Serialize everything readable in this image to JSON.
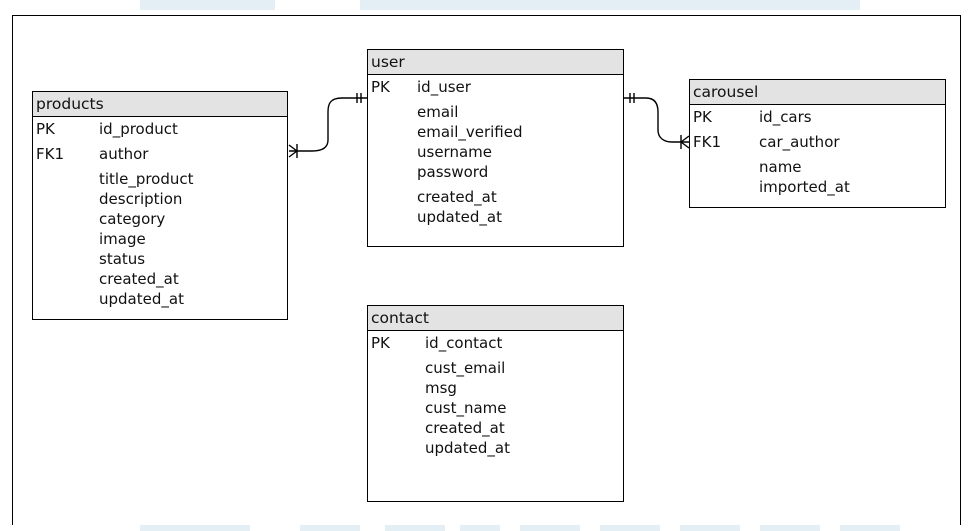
{
  "entities": {
    "products": {
      "title": "products",
      "keys": [
        {
          "tag": "PK",
          "name": "id_product"
        },
        {
          "tag": "FK1",
          "name": "author"
        }
      ],
      "fields": [
        "title_product",
        "description",
        "category",
        "image",
        "status",
        "created_at",
        "updated_at"
      ]
    },
    "user": {
      "title": "user",
      "keys": [
        {
          "tag": "PK",
          "name": "id_user"
        }
      ],
      "fields": [
        "email",
        "email_verified",
        "username",
        "password"
      ],
      "fields2": [
        "created_at",
        "updated_at"
      ]
    },
    "carousel": {
      "title": "carousel",
      "keys": [
        {
          "tag": "PK",
          "name": "id_cars"
        },
        {
          "tag": "FK1",
          "name": "car_author"
        }
      ],
      "fields": [
        "name",
        "imported_at"
      ]
    },
    "contact": {
      "title": "contact",
      "keys": [
        {
          "tag": "PK",
          "name": "id_contact"
        }
      ],
      "fields": [
        "cust_email",
        "msg",
        "cust_name",
        "created_at",
        "updated_at"
      ]
    }
  },
  "relationships": [
    {
      "from": "user.id_user",
      "to": "products.author",
      "notation": "one-to-many"
    },
    {
      "from": "user.id_user",
      "to": "carousel.car_author",
      "notation": "one-to-many"
    }
  ]
}
